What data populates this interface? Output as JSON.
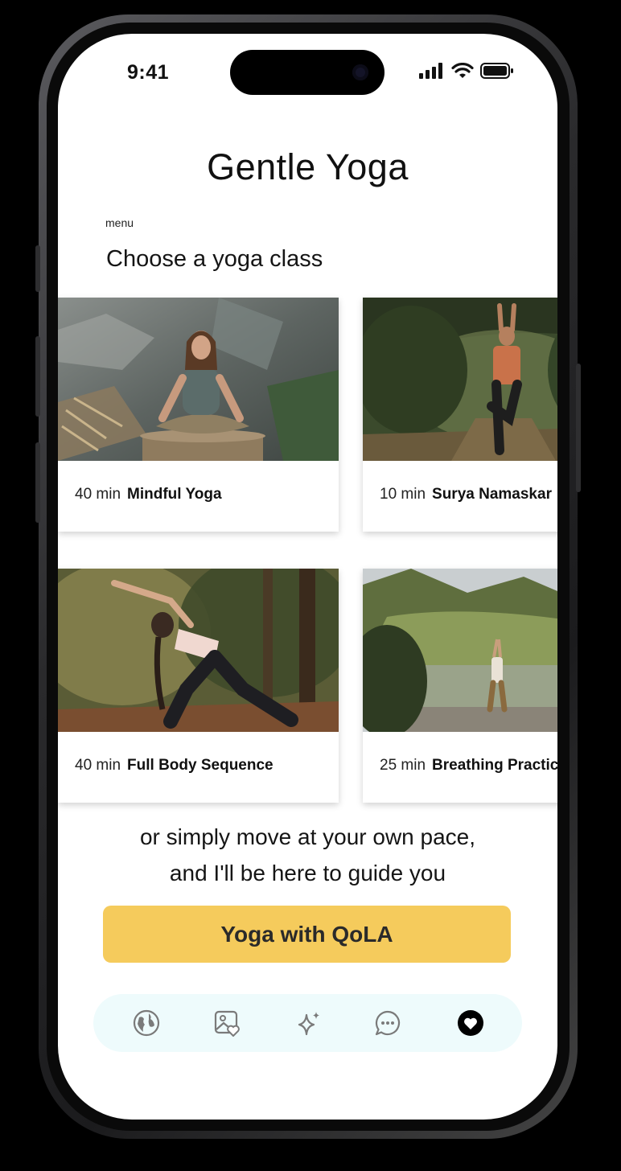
{
  "status_bar": {
    "time": "9:41"
  },
  "header": {
    "title": "Gentle Yoga",
    "menu_label": "menu"
  },
  "section": {
    "title": "Choose a yoga class"
  },
  "classes": [
    {
      "duration": "40 min",
      "name": "Mindful Yoga"
    },
    {
      "duration": "10 min",
      "name": "Surya Namaskar"
    },
    {
      "duration": "40 min",
      "name": "Full Body Sequence"
    },
    {
      "duration": "25 min",
      "name": "Breathing Practice"
    }
  ],
  "guide_text": {
    "line1": "or simply move at your own pace,",
    "line2": "and I'll be here to guide you"
  },
  "cta": {
    "label": "Yoga with QoLA"
  },
  "tabbar": {
    "items": [
      {
        "icon": "globe-icon",
        "active": false
      },
      {
        "icon": "photo-heart-icon",
        "active": false
      },
      {
        "icon": "sparkle-icon",
        "active": false
      },
      {
        "icon": "chat-bubble-icon",
        "active": false
      },
      {
        "icon": "heart-icon",
        "active": true
      }
    ]
  },
  "colors": {
    "accent": "#F5CB5C",
    "tabbar_bg": "#eefbfc",
    "text": "#111111"
  }
}
